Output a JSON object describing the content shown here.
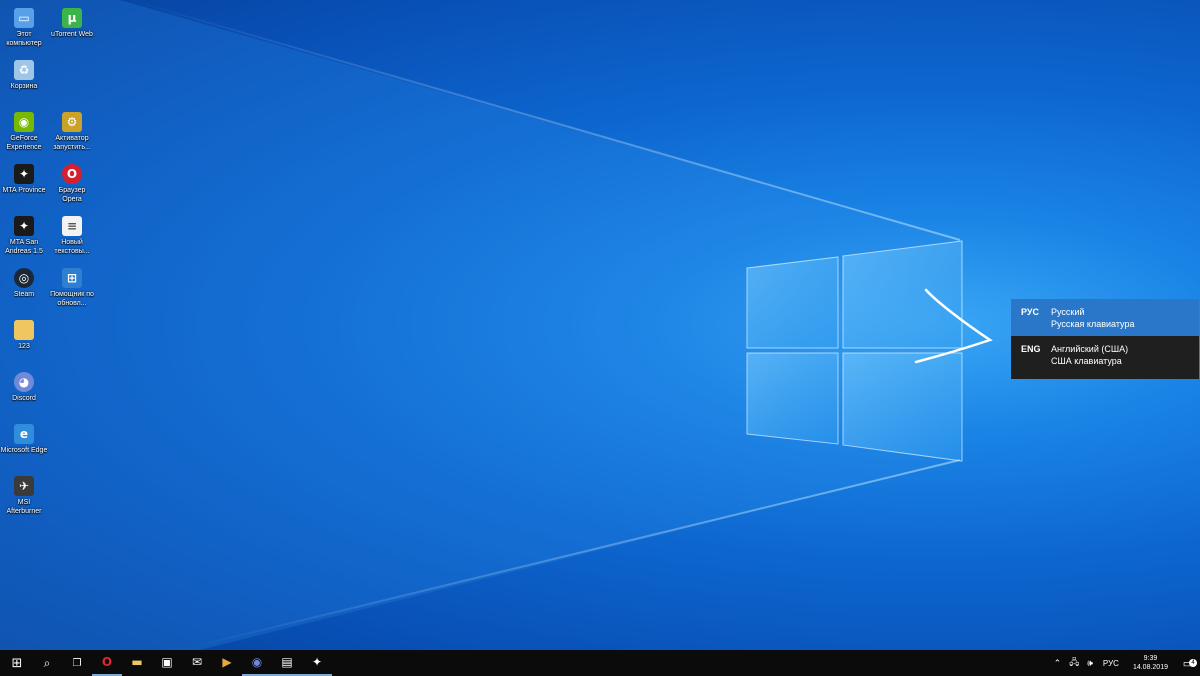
{
  "desktop_icons": [
    {
      "label": "Этот компьютер",
      "icon": "computer-icon",
      "color": "#5aa0e8"
    },
    {
      "label": "uTorrent Web",
      "icon": "utorrent-icon",
      "color": "#3bb54a"
    },
    {
      "label": "Корзина",
      "icon": "recycle-bin-icon",
      "color": "#9fc6e6"
    },
    {
      "label": "GeForce Experience",
      "icon": "geforce-icon",
      "color": "#76b900"
    },
    {
      "label": "Активатор запустить...",
      "icon": "activator-icon",
      "color": "#c9a227"
    },
    {
      "label": "MTA Province",
      "icon": "mta-province-icon",
      "color": "#1a1a1a"
    },
    {
      "label": "Браузер Opera",
      "icon": "opera-icon",
      "color": "#d6202f"
    },
    {
      "label": "MTA San Andreas 1.5",
      "icon": "mta-sa-icon",
      "color": "#1a1a1a"
    },
    {
      "label": "Новый текстовы...",
      "icon": "text-file-icon",
      "color": "#f2f2f2"
    },
    {
      "label": "Steam",
      "icon": "steam-icon",
      "color": "#1b2838"
    },
    {
      "label": "Помощник по обновл...",
      "icon": "update-assistant-icon",
      "color": "#2f7fd0"
    },
    {
      "label": "123",
      "icon": "folder-icon",
      "color": "#f0c75e"
    },
    {
      "label": "Discord",
      "icon": "discord-icon",
      "color": "#7289da"
    },
    {
      "label": "Microsoft Edge",
      "icon": "edge-icon",
      "color": "#2f8ddc"
    },
    {
      "label": "MSI Afterburner",
      "icon": "msi-afterburner-icon",
      "color": "#3a3a3a"
    }
  ],
  "language_popup": {
    "items": [
      {
        "code": "РУС",
        "language": "Русский",
        "keyboard": "Русская клавиатура",
        "selected": true
      },
      {
        "code": "ENG",
        "language": "Английский (США)",
        "keyboard": "США клавиатура",
        "selected": false
      }
    ]
  },
  "taskbar": {
    "apps": [
      {
        "icon": "windows-start-icon",
        "glyph": "⊞",
        "running": false
      },
      {
        "icon": "search-icon",
        "glyph": "⌕",
        "running": false
      },
      {
        "icon": "task-view-icon",
        "glyph": "❐",
        "running": false
      },
      {
        "icon": "opera-icon",
        "glyph": "O",
        "running": true,
        "color": "#e0262f"
      },
      {
        "icon": "file-explorer-icon",
        "glyph": "▬",
        "running": false,
        "color": "#f0c75e"
      },
      {
        "icon": "store-icon",
        "glyph": "▣",
        "running": false
      },
      {
        "icon": "mail-icon",
        "glyph": "✉",
        "running": false
      },
      {
        "icon": "media-player-icon",
        "glyph": "▶",
        "running": false,
        "color": "#e5a93b"
      },
      {
        "icon": "discord-icon",
        "glyph": "◉",
        "running": true,
        "color": "#7289da"
      },
      {
        "icon": "notepad-icon",
        "glyph": "▤",
        "running": true
      },
      {
        "icon": "mta-icon",
        "glyph": "✦",
        "running": true
      }
    ],
    "tray": {
      "language": "РУС",
      "time": "9:39",
      "date": "14.08.2019",
      "notification_count": "4"
    }
  }
}
